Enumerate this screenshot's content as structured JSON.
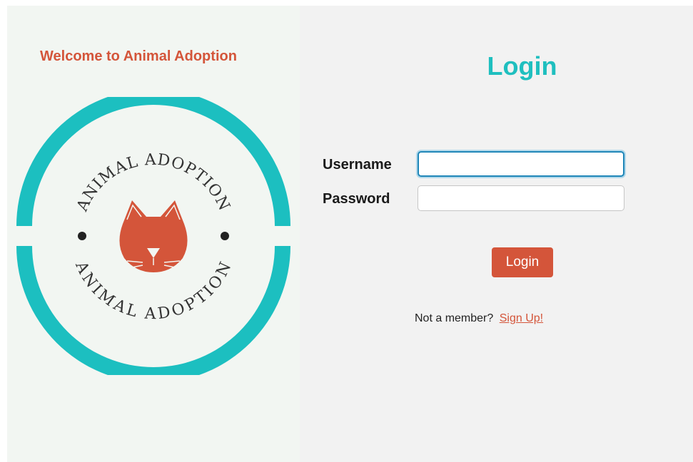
{
  "left_panel": {
    "welcome_text": "Welcome to Animal Adoption",
    "logo": {
      "arc_top_text": "ANIMAL ADOPTION",
      "arc_bottom_text": "ANIMAL ADOPTION",
      "icon": "cat-face-icon",
      "colors": {
        "ring": "#1cbfc0",
        "cat": "#d4553a",
        "text": "#333333"
      }
    }
  },
  "login_form": {
    "title": "Login",
    "username_label": "Username",
    "username_value": "",
    "password_label": "Password",
    "password_value": "",
    "submit_label": "Login",
    "signup_prompt": "Not a member?",
    "signup_link": "Sign Up!"
  },
  "colors": {
    "accent": "#d4553a",
    "title": "#1fbfbf",
    "focus": "#1f86b8"
  }
}
